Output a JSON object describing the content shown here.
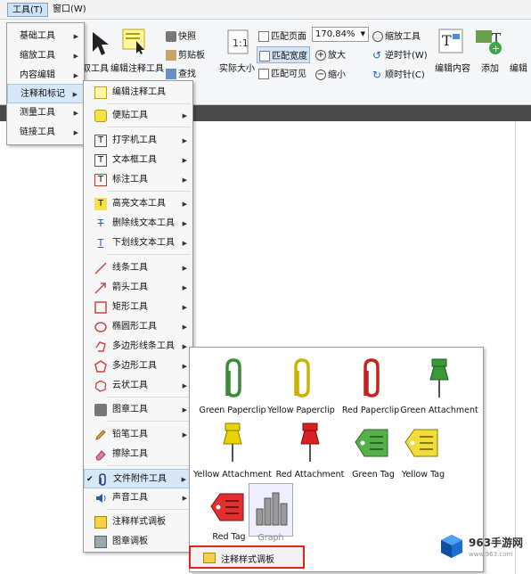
{
  "menubar": {
    "tool_menu": "工具(T)",
    "window_menu": "窗口(W)"
  },
  "ribbon": {
    "select_tool": "取工具",
    "edit_annot_tool": "编辑注释工具",
    "snapshot": "快照",
    "clipboard": "剪贴板",
    "find": "查找",
    "actual_size": "实际大小",
    "fit_page": "匹配页面",
    "fit_width": "匹配宽度",
    "fit_visible": "匹配可见",
    "zoom_value": "170.84%",
    "zoom_in": "放大",
    "zoom_out": "缩小",
    "zoom_tool": "缩放工具",
    "rotate_ccw": "逆时针(W)",
    "rotate_cw": "顺时针(C)",
    "edit_content": "编辑内容",
    "add": "添加",
    "edit_right": "编辑"
  },
  "menu1": {
    "items": [
      {
        "label": "基础工具",
        "arrow": "▶"
      },
      {
        "label": "缩放工具",
        "arrow": "▶"
      },
      {
        "label": "内容编辑",
        "arrow": "▶"
      },
      {
        "label": "注释和标记",
        "arrow": "▶"
      },
      {
        "label": "测量工具",
        "arrow": "▶"
      },
      {
        "label": "链接工具",
        "arrow": "▶"
      }
    ]
  },
  "menu2": {
    "items": [
      {
        "label": "编辑注释工具"
      },
      {
        "label": "便贴工具",
        "arrow": "▶"
      },
      {
        "label": "打字机工具",
        "arrow": "▶"
      },
      {
        "label": "文本框工具",
        "arrow": "▶"
      },
      {
        "label": "标注工具",
        "arrow": "▶"
      },
      {
        "label": "高亮文本工具",
        "arrow": "▶"
      },
      {
        "label": "删除线文本工具",
        "arrow": "▶"
      },
      {
        "label": "下划线文本工具",
        "arrow": "▶"
      },
      {
        "label": "线条工具",
        "arrow": "▶"
      },
      {
        "label": "箭头工具",
        "arrow": "▶"
      },
      {
        "label": "矩形工具",
        "arrow": "▶"
      },
      {
        "label": "椭圆形工具",
        "arrow": "▶"
      },
      {
        "label": "多边形线条工具",
        "arrow": "▶"
      },
      {
        "label": "多边形工具",
        "arrow": "▶"
      },
      {
        "label": "云状工具",
        "arrow": "▶"
      },
      {
        "label": "图章工具",
        "arrow": "▶"
      },
      {
        "label": "铅笔工具",
        "arrow": "▶"
      },
      {
        "label": "擦除工具"
      },
      {
        "label": "文件附件工具",
        "arrow": "▶",
        "check": "✔"
      },
      {
        "label": "声音工具",
        "arrow": "▶"
      },
      {
        "label": "注释样式调板"
      },
      {
        "label": "图章调板"
      }
    ]
  },
  "attachments": {
    "items": [
      {
        "label": "Green Paperclip",
        "color": "#3a8a3a"
      },
      {
        "label": "Yellow Paperclip",
        "color": "#c8b400"
      },
      {
        "label": "Red Paperclip",
        "color": "#c82020"
      },
      {
        "label": "Green Attachment",
        "color": "#3a9a3a"
      },
      {
        "label": "Yellow Attachment",
        "color": "#e8d400"
      },
      {
        "label": "Red Attachment",
        "color": "#d82020"
      },
      {
        "label": "Green Tag",
        "color": "#55b04a"
      },
      {
        "label": "Yellow Tag",
        "color": "#f0dc3a"
      },
      {
        "label": "Red Tag",
        "color": "#e03030"
      },
      {
        "label": "Graph",
        "color": "#8a8a8a"
      }
    ],
    "footer_label": "注释样式调板"
  },
  "watermark": {
    "text": "963手游网",
    "sub": "www.963.com"
  }
}
